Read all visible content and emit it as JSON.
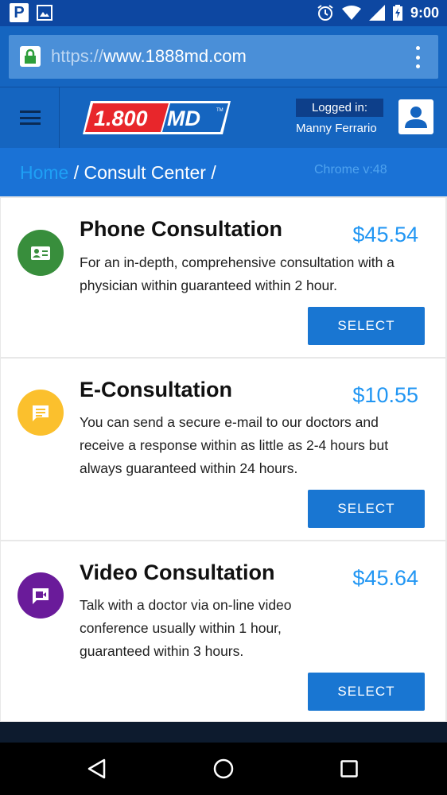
{
  "status_bar": {
    "time": "9:00",
    "left_icons": [
      "parking-icon",
      "image-icon"
    ],
    "right_icons": [
      "alarm-icon",
      "wifi-icon",
      "signal-icon",
      "battery-icon"
    ],
    "p_badge": "P"
  },
  "browser": {
    "url_scheme": "https://",
    "url_host": "www.1888md.com",
    "lock_color": "#2e9e3b"
  },
  "header": {
    "logo_number": "1.800",
    "logo_md": "MD",
    "logo_tm": "TM",
    "logged_in_label": "Logged in:",
    "user_name": "Manny Ferrario"
  },
  "breadcrumb": {
    "home": "Home",
    "separator_1": " / ",
    "current": "Consult Center /",
    "chrome_version": "Chrome v:48"
  },
  "consultations": [
    {
      "title": "Phone Consultation",
      "price": "$45.54",
      "description": "For an in-depth, comprehensive consultation with a physician within guaranteed within 2 hour.",
      "button": "SELECT",
      "icon": "contact-card-icon",
      "color": "#388e3c"
    },
    {
      "title": "E-Consultation",
      "price": "$10.55",
      "description": "You can send a secure e-mail to our doctors and receive a response within as little as 2-4 hours but always guaranteed within 24 hours.",
      "button": "SELECT",
      "icon": "message-icon",
      "color": "#fbc02d"
    },
    {
      "title": "Video Consultation",
      "price": "$45.64",
      "description": "Talk with a doctor via on-line video conference usually within 1 hour, guaranteed within 3 hours.",
      "button": "SELECT",
      "icon": "video-icon",
      "color": "#6a1b9a"
    }
  ],
  "colors": {
    "primary": "#1565c0",
    "price": "#2196f3",
    "button": "#1976d2"
  }
}
